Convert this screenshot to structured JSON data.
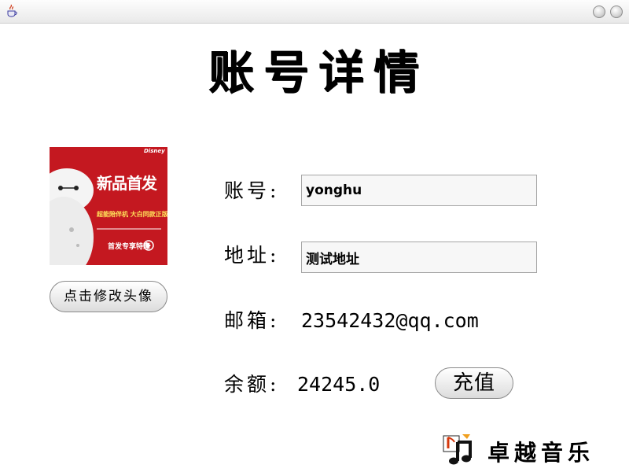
{
  "window": {
    "app_icon": "java-cup-icon",
    "buttons": [
      "minimize",
      "close"
    ]
  },
  "page": {
    "title": "账号详情"
  },
  "avatar": {
    "banner_title": "新品首发",
    "banner_subtitle": "超能陪伴机 大白同款正版授权",
    "banner_cta": "首发专享特惠",
    "banner_brand": "Disney",
    "change_button": "点击修改头像"
  },
  "form": {
    "account": {
      "label": "账号:",
      "value": "yonghu"
    },
    "address": {
      "label": "地址:",
      "value": "测试地址"
    },
    "email": {
      "label": "邮箱:",
      "value": "23542432@qq.com"
    },
    "balance": {
      "label": "余额:",
      "value": "24245.0"
    },
    "recharge_button": "充值"
  },
  "footer": {
    "brand": "卓越音乐",
    "logo_icon": "music-note-icon"
  },
  "colors": {
    "banner_red": "#c41820",
    "input_bg": "#f7f7f7",
    "input_border": "#a5a5a5"
  }
}
